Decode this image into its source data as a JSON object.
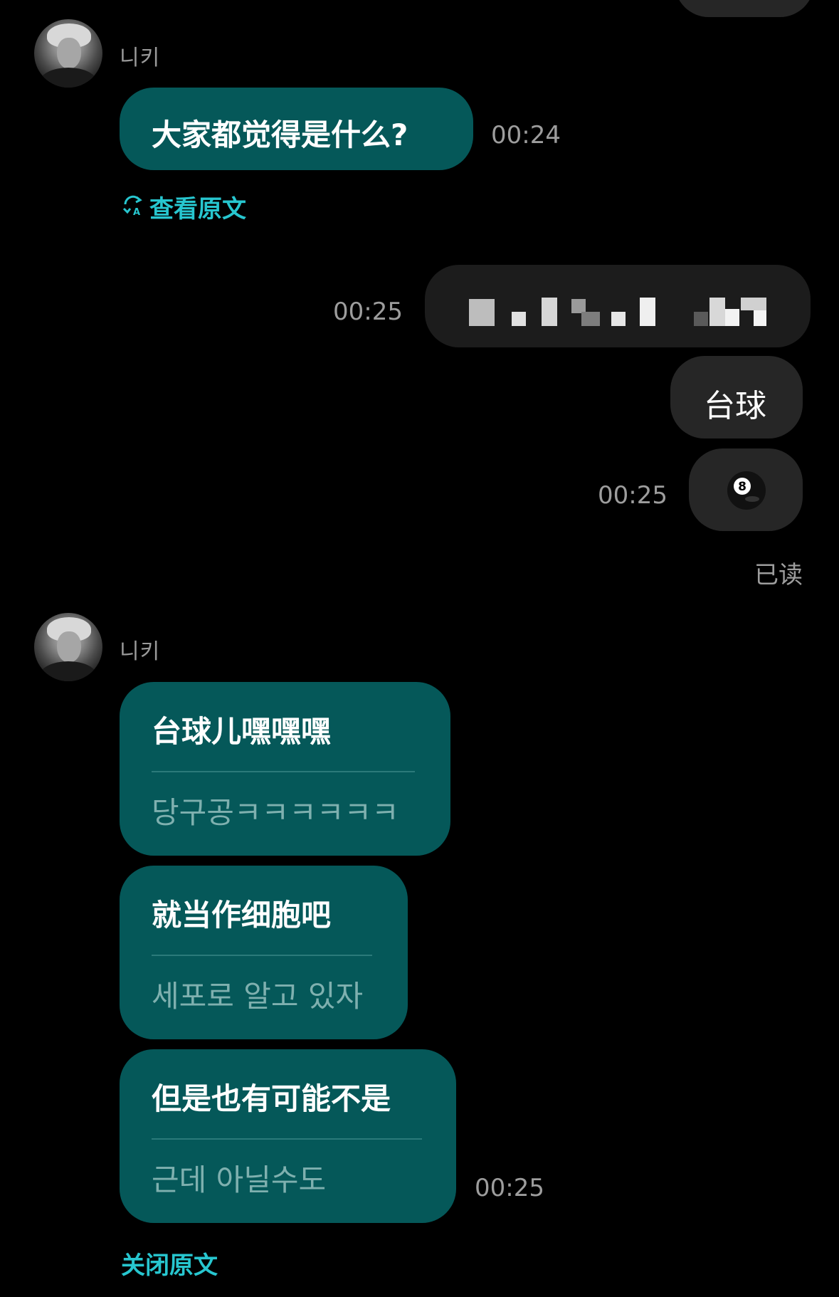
{
  "colors": {
    "background": "#000000",
    "incoming_bubble": "#055859",
    "outgoing_bubble": "#262626",
    "link_accent": "#27c6cf",
    "translation_text": "#7fb0af",
    "timestamp": "#9d9d9d"
  },
  "messages": {
    "group1": {
      "sender": "니키",
      "text": "大家都觉得是什么?",
      "time": "00:24",
      "view_original_label": "查看原文"
    },
    "outgoing": {
      "time1": "00:25",
      "text2": "台球",
      "emoji": "🎱",
      "time3": "00:25",
      "read_status": "已读"
    },
    "group2": {
      "sender": "니키",
      "items": [
        {
          "text": "台球儿嘿嘿嘿",
          "original": "당구공ㅋㅋㅋㅋㅋㅋ"
        },
        {
          "text": "就当作细胞吧",
          "original": "세포로 알고 있자"
        },
        {
          "text": "但是也有可能不是",
          "original": "근데 아닐수도"
        }
      ],
      "time": "00:25",
      "close_original_label": "关闭原文"
    }
  },
  "icons": {
    "translate": "translate-refresh-icon",
    "avatar": "profile-avatar"
  }
}
